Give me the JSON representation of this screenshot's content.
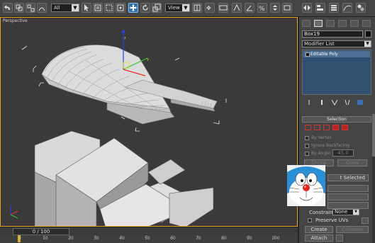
{
  "toolbar": {
    "selection_filter": "All",
    "ref_coord": "View",
    "icons": [
      "undo-icon",
      "redo-icon",
      "link-icon",
      "unlink-icon",
      "bind-space-warp-icon",
      "select-object-icon",
      "select-by-name-icon",
      "rect-selection-icon",
      "window-crossing-icon",
      "select-move-icon",
      "select-rotate-icon",
      "select-scale-icon",
      "pivot-icon",
      "manipulate-icon",
      "snap-icon",
      "angle-snap-icon",
      "percent-snap-icon",
      "spinner-snap-icon",
      "named-selection-icon",
      "mirror-icon",
      "align-icon"
    ]
  },
  "viewport": {
    "label": "Perspective",
    "border_color": "#e8a11e",
    "background": "#3a3a3a"
  },
  "timeline": {
    "frame": "0 / 100",
    "ticks": [
      "0",
      "10",
      "20",
      "30",
      "40",
      "50",
      "60",
      "70",
      "80",
      "90",
      "100"
    ]
  },
  "panel": {
    "tabs": [
      "create-tab",
      "modify-tab",
      "hierarchy-tab",
      "motion-tab",
      "display-tab",
      "utilities-tab"
    ],
    "object_name": "Box19",
    "modifier_list": "Modifier List",
    "stack_item": "Editable Poly",
    "selection_rollout": "Selection",
    "by_vertex": "By Vertex",
    "ignore_backfacing": "Ignore Backfacing",
    "by_angle": "By Angle:",
    "by_angle_value": "45.0",
    "shrink": "Shrink",
    "grow": "Grow",
    "select_label": "t Selected",
    "constraints_label": "Constraints:",
    "constraints_value": "None",
    "preserve_uvs": "Preserve UVs",
    "create": "Create",
    "collapse": "Collapse",
    "attach": "Attach",
    "accent": "#305070"
  }
}
